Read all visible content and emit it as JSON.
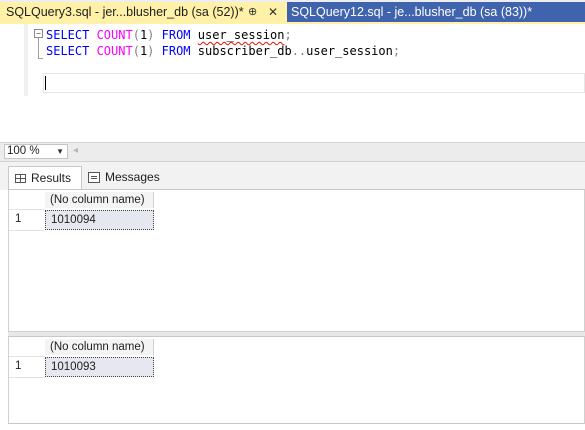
{
  "tabs": {
    "active": {
      "title": "SQLQuery3.sql - jer...blusher_db (sa (52))*",
      "pin_glyph": "⊕",
      "close_glyph": "✕"
    },
    "inactive": {
      "title": "SQLQuery12.sql - je...blusher_db (sa (83))*"
    }
  },
  "editor": {
    "fold_glyph": "−",
    "lines": [
      {
        "kw1": "SELECT ",
        "fn": "COUNT",
        "paren_open": "(",
        "arg": "1",
        "paren_close": ")",
        "kw2": " FROM ",
        "table": "user_session",
        "semi": ";"
      },
      {
        "kw1": "SELECT ",
        "fn": "COUNT",
        "paren_open": "(",
        "arg": "1",
        "paren_close": ")",
        "kw2": " FROM ",
        "table": "subscriber_db",
        "dots": "..",
        "table2": "user_session",
        "semi": ";"
      }
    ]
  },
  "zoom": {
    "value": "100 %",
    "arrow": "▼",
    "scroll_left": "◂"
  },
  "results": {
    "tabs": {
      "results": "Results",
      "messages": "Messages"
    },
    "grids": [
      {
        "column": "(No column name)",
        "rows": [
          {
            "num": "1",
            "value": "1010094"
          }
        ]
      },
      {
        "column": "(No column name)",
        "rows": [
          {
            "num": "1",
            "value": "1010093"
          }
        ]
      }
    ]
  },
  "colors": {
    "active_tab": "#fff1a8",
    "inactive_tab": "#3f63ad",
    "keyword": "#0000ff",
    "function": "#ff00ff",
    "operator": "#808080"
  }
}
